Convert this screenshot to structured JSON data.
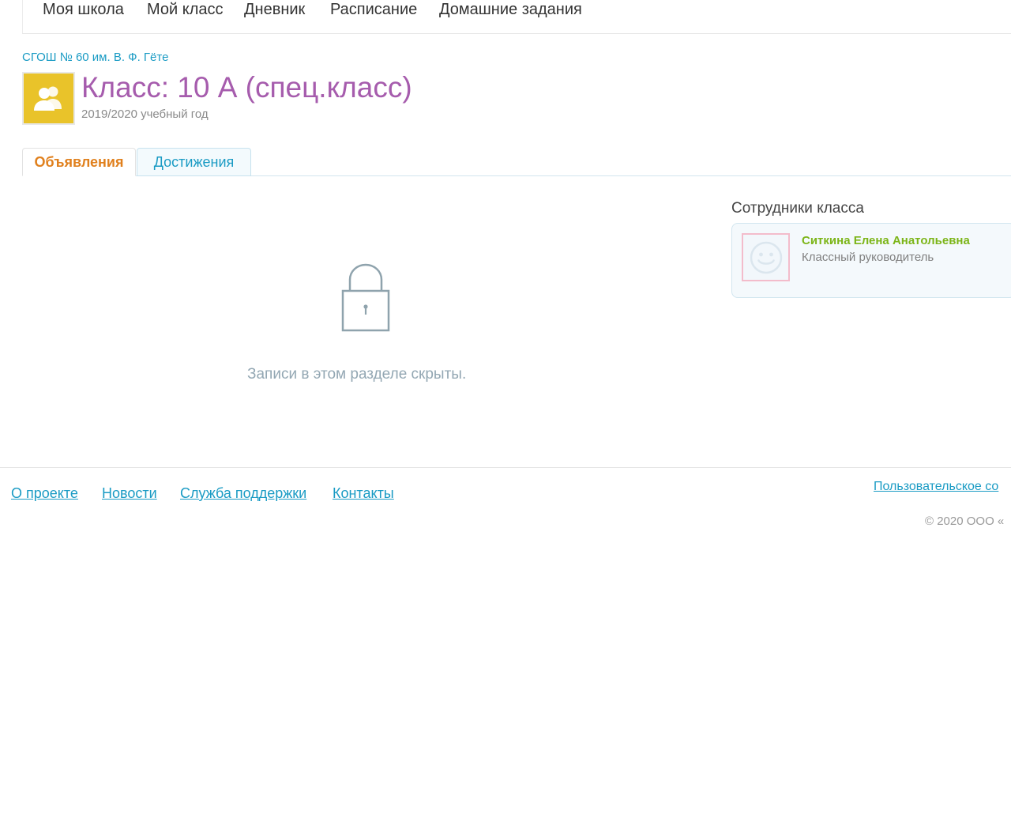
{
  "nav": {
    "items": [
      {
        "label": "Моя школа"
      },
      {
        "label": "Мой класс"
      },
      {
        "label": "Дневник"
      },
      {
        "label": "Расписание"
      },
      {
        "label": "Домашние задания"
      }
    ]
  },
  "header": {
    "school": "СГОШ № 60 им. В. Ф. Гёте",
    "title": "Класс: 10 А (спец.класс)",
    "year": "2019/2020 учебный год",
    "avatar_icon": "group-icon",
    "avatar_color": "#e9c32a"
  },
  "tabs": [
    {
      "label": "Объявления",
      "active": true
    },
    {
      "label": "Достижения",
      "active": false
    }
  ],
  "content": {
    "lock_icon": "lock-icon",
    "hidden_message": "Записи в этом разделе скрыты."
  },
  "staff": {
    "title": "Сотрудники класса",
    "members": [
      {
        "name": "Ситкина Елена Анатольевна",
        "role": "Классный руководитель",
        "avatar_icon": "smiley-icon"
      }
    ]
  },
  "footer": {
    "links": [
      {
        "label": "О проекте"
      },
      {
        "label": "Новости"
      },
      {
        "label": "Служба поддержки"
      },
      {
        "label": "Контакты"
      }
    ],
    "right_link": "Пользовательское со",
    "copyright": "© 2020 ООО «"
  },
  "colors": {
    "accent_link": "#1a9bc4",
    "title": "#a65cad",
    "active_tab": "#e0801d",
    "staff_name": "#7cb518"
  }
}
